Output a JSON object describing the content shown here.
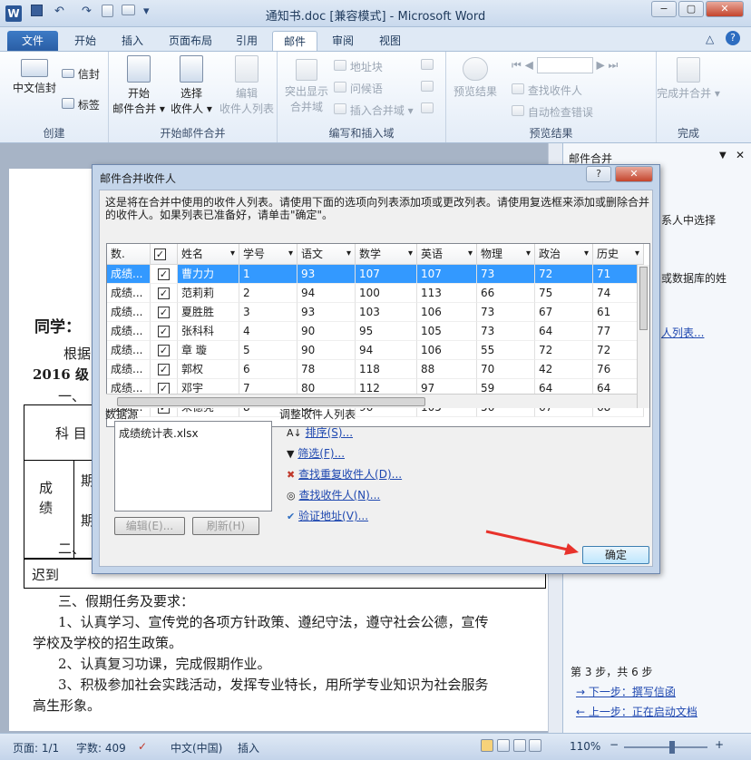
{
  "window": {
    "title": "通知书.doc [兼容模式] - Microsoft Word",
    "min": "−",
    "max": "▢",
    "close": "✕",
    "word_logo": "W"
  },
  "qat": {
    "save": "▪",
    "undo": "↶",
    "redo": "↷",
    "sep": "▾"
  },
  "tabs": [
    "文件",
    "开始",
    "插入",
    "页面布局",
    "引用",
    "邮件",
    "审阅",
    "视图"
  ],
  "ribbon": {
    "groups": [
      {
        "label": "创建",
        "buttons": [
          "中文信封",
          "信封",
          "标签"
        ]
      },
      {
        "label": "开始邮件合并",
        "buttons": [
          "开始\n邮件合并 ▾",
          "选择\n收件人 ▾",
          "编辑\n收件人列表"
        ]
      },
      {
        "label": "编写和插入域",
        "buttons": [
          "突出显示\n合并域",
          "地址块",
          "问候语",
          "插入合并域 ▾"
        ]
      },
      {
        "label": "预览结果",
        "buttons": [
          "预览结果",
          "查找收件人",
          "自动检查错误"
        ]
      },
      {
        "label": "完成",
        "buttons": [
          "完成并合并 ▾"
        ]
      }
    ]
  },
  "document": {
    "lines": [
      "同学：",
      "根据",
      "2016 级",
      "一、",
      "科  目",
      "成绩",
      "期",
      "期",
      "二、",
      "迟到",
      "三、假期任务及要求：",
      "1、认真学习、宣传党的各项方针政策、遵纪守法，遵守社会公德，宣传",
      "学校及学校的招生政策。",
      "2、认真复习功课，完成假期作业。",
      "3、积极参加社会实践活动，发挥专业特长，用所学专业知识为社会服务",
      "高生形象。"
    ]
  },
  "task_pane": {
    "title": "邮件合并",
    "text1": "系人中选择",
    "text2": "或数据库的姓",
    "link1": "人列表...",
    "step": "第 3 步，共 6 步",
    "next": "下一步：撰写信函",
    "prev": "上一步：正在启动文档"
  },
  "dialog": {
    "title": "邮件合并收件人",
    "help": "?",
    "close": "✕",
    "intro": "这是将在合并中使用的收件人列表。请使用下面的选项向列表添加项或更改列表。请使用复选框来添加或删除合并的收件人。如果列表已准备好，请单击\"确定\"。",
    "columns": [
      "数.",
      "✓",
      "姓名",
      "学号",
      "语文",
      "数学",
      "英语",
      "物理",
      "政治",
      "历史"
    ],
    "rows": [
      {
        "src": "成绩...",
        "name": "曹力力",
        "id": "1",
        "chinese": "93",
        "math": "107",
        "english": "107",
        "physics": "73",
        "politics": "72",
        "history": "71"
      },
      {
        "src": "成绩...",
        "name": "范莉莉",
        "id": "2",
        "chinese": "94",
        "math": "100",
        "english": "113",
        "physics": "66",
        "politics": "75",
        "history": "74"
      },
      {
        "src": "成绩...",
        "name": "夏胜胜",
        "id": "3",
        "chinese": "93",
        "math": "103",
        "english": "106",
        "physics": "73",
        "politics": "67",
        "history": "61"
      },
      {
        "src": "成绩...",
        "name": "张科科",
        "id": "4",
        "chinese": "90",
        "math": "95",
        "english": "105",
        "physics": "73",
        "politics": "64",
        "history": "77"
      },
      {
        "src": "成绩...",
        "name": "章  璇",
        "id": "5",
        "chinese": "90",
        "math": "94",
        "english": "106",
        "physics": "55",
        "politics": "72",
        "history": "72"
      },
      {
        "src": "成绩...",
        "name": "郭权",
        "id": "6",
        "chinese": "78",
        "math": "118",
        "english": "88",
        "physics": "70",
        "politics": "42",
        "history": "76"
      },
      {
        "src": "成绩...",
        "name": "邓宇",
        "id": "7",
        "chinese": "80",
        "math": "112",
        "english": "97",
        "physics": "59",
        "politics": "64",
        "history": "64"
      },
      {
        "src": "成绩...",
        "name": "朱德亮",
        "id": "8",
        "chinese": "82",
        "math": "96",
        "english": "105",
        "physics": "56",
        "politics": "67",
        "history": "68"
      }
    ],
    "datasource_label": "数据源",
    "datasource_item": "成绩统计表.xlsx",
    "edit_btn": "编辑(E)...",
    "refresh_btn": "刷新(H)",
    "adjust_label": "调整收件人列表",
    "links": [
      "排序(S)...",
      "筛选(F)...",
      "查找重复收件人(D)...",
      "查找收件人(N)...",
      "验证地址(V)..."
    ],
    "ok": "确定"
  },
  "status": {
    "page": "页面: 1/1",
    "words": "字数: 409",
    "lang": "中文(中国)",
    "mode": "插入",
    "zoom": "110%",
    "minus": "−",
    "plus": "+"
  },
  "colors": {
    "selected_row": "#3399ff",
    "arrow": "#e8322b"
  }
}
